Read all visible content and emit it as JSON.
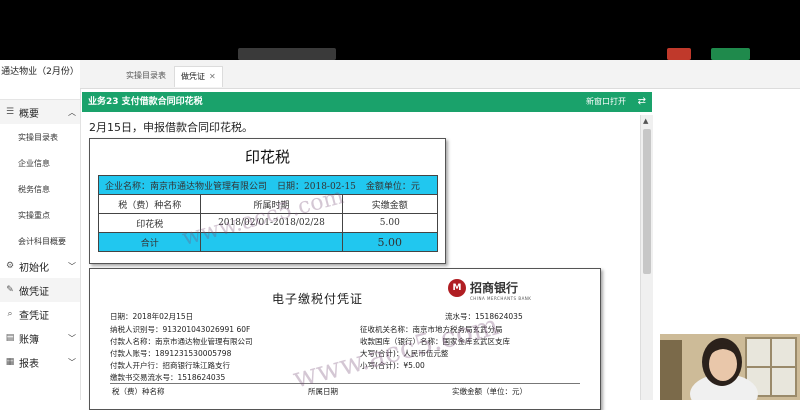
{
  "sidebar": {
    "company": "通达物业（2月份）",
    "items": [
      {
        "label": "概要",
        "icon": "list-icon",
        "expanded": true
      },
      {
        "label": "实操目录表"
      },
      {
        "label": "企业信息"
      },
      {
        "label": "税务信息"
      },
      {
        "label": "实操重点"
      },
      {
        "label": "会计科目概要"
      },
      {
        "label": "初始化",
        "icon": "settings-icon"
      },
      {
        "label": "做凭证",
        "icon": "edit-icon"
      },
      {
        "label": "查凭证",
        "icon": "search-icon"
      },
      {
        "label": "账簿",
        "icon": "book-icon"
      },
      {
        "label": "报表",
        "icon": "report-icon"
      }
    ]
  },
  "tabs": [
    {
      "label": "实操目录表"
    },
    {
      "label": "做凭证",
      "active": true
    }
  ],
  "task": {
    "title": "业务23 支付借款合同印花税",
    "new_window": "新窗口打开",
    "description": "2月15日，申报借款合同印花税。"
  },
  "stamp_table": {
    "title": "印花税",
    "company": "企业名称：南京市通达物业管理有限公司",
    "date": "日期：2018-02-15",
    "unit": "金额单位：元",
    "headers": [
      "税（费）种名称",
      "所属时期",
      "实缴金额"
    ],
    "rows": [
      {
        "name": "印花税",
        "period": "2018/02/01-2018/02/28",
        "amount": "5.00"
      }
    ],
    "total_label": "合计",
    "total_amount": "5.00"
  },
  "receipt": {
    "title": "电子缴税付凭证",
    "bank_name": "招商银行",
    "bank_en": "CHINA MERCHANTS BANK",
    "date": "日期：2018年02月15日",
    "serial": "流水号：1518624035",
    "taxpayer_id": "纳税人识别号：913201043026991 60F",
    "payer": "付款人名称：南京市通达物业管理有限公司",
    "account": "付款人账号：1891231530005798",
    "bank": "付款人开户行：招商银行珠江路支行",
    "trans_no": "缴款书交易流水号：1518624035",
    "tax_office": "征收机关名称：南京市地方税务局玄武分局",
    "treasury": "收款国库（银行）名称：国家金库玄武区支库",
    "amount_upper": "大写(合计)：人民币伍元整",
    "amount_lower": "小写(合计)：¥5.00",
    "col1": "税（费）种名称",
    "col2": "所属日期",
    "col3": "实缴金额（单位：元）"
  },
  "watermark": "www.acc5.com"
}
